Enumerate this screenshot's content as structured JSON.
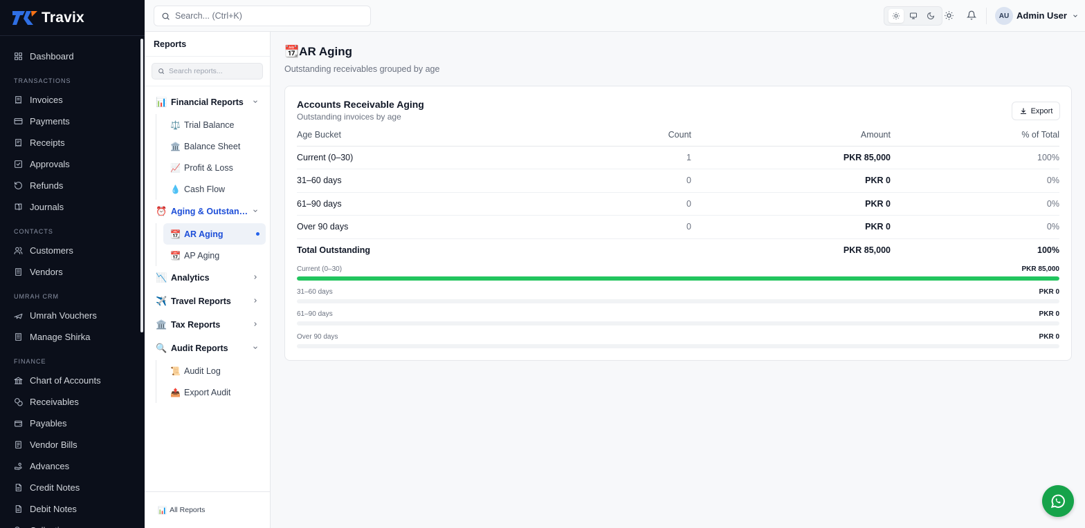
{
  "app": {
    "name": "Travix"
  },
  "sidebar": {
    "items": [
      {
        "label": "Dashboard",
        "icon": "dashboard-icon"
      },
      {
        "section": "TRANSACTIONS"
      },
      {
        "label": "Invoices",
        "icon": "invoice-icon"
      },
      {
        "label": "Payments",
        "icon": "card-icon"
      },
      {
        "label": "Receipts",
        "icon": "receipt-icon"
      },
      {
        "label": "Approvals",
        "icon": "check-square-icon"
      },
      {
        "label": "Refunds",
        "icon": "refund-icon"
      },
      {
        "label": "Journals",
        "icon": "book-icon"
      },
      {
        "section": "CONTACTS"
      },
      {
        "label": "Customers",
        "icon": "users-icon"
      },
      {
        "label": "Vendors",
        "icon": "building-icon"
      },
      {
        "section": "UMRAH CRM"
      },
      {
        "label": "Umrah Vouchers",
        "icon": "plane-icon"
      },
      {
        "label": "Manage Shirka",
        "icon": "building-icon"
      },
      {
        "section": "FINANCE"
      },
      {
        "label": "Chart of Accounts",
        "icon": "landmark-icon"
      },
      {
        "label": "Receivables",
        "icon": "coins-icon"
      },
      {
        "label": "Payables",
        "icon": "wallet-icon"
      },
      {
        "label": "Vendor Bills",
        "icon": "bill-icon"
      },
      {
        "label": "Advances",
        "icon": "hand-coins-icon"
      },
      {
        "label": "Credit Notes",
        "icon": "file-icon"
      },
      {
        "label": "Debit Notes",
        "icon": "file-icon"
      },
      {
        "label": "Collections",
        "icon": "coins-icon"
      }
    ]
  },
  "topbar": {
    "search_placeholder": "Search... (Ctrl+K)",
    "user": {
      "initials": "AU",
      "name": "Admin User"
    }
  },
  "reports_panel": {
    "title": "Reports",
    "search_placeholder": "Search reports...",
    "groups": [
      {
        "label": "Financial Reports",
        "icon": "📊",
        "expanded": true,
        "items": [
          {
            "label": "Trial Balance",
            "icon": "⚖️"
          },
          {
            "label": "Balance Sheet",
            "icon": "🏛️"
          },
          {
            "label": "Profit & Loss",
            "icon": "📈"
          },
          {
            "label": "Cash Flow",
            "icon": "💧"
          }
        ]
      },
      {
        "label": "Aging & Outstanding",
        "icon": "⏰",
        "expanded": true,
        "active": true,
        "items": [
          {
            "label": "AR Aging",
            "icon": "📆",
            "selected": true
          },
          {
            "label": "AP Aging",
            "icon": "📆"
          }
        ]
      },
      {
        "label": "Analytics",
        "icon": "📉",
        "expanded": false,
        "items": []
      },
      {
        "label": "Travel Reports",
        "icon": "✈️",
        "expanded": false,
        "items": []
      },
      {
        "label": "Tax Reports",
        "icon": "🏛️",
        "expanded": false,
        "items": []
      },
      {
        "label": "Audit Reports",
        "icon": "🔍",
        "expanded": true,
        "items": [
          {
            "label": "Audit Log",
            "icon": "📜"
          },
          {
            "label": "Export Audit",
            "icon": "📤"
          }
        ]
      }
    ],
    "footer_label": "All Reports",
    "footer_icon": "📊"
  },
  "page": {
    "title_icon": "📆",
    "title": "AR Aging",
    "subtitle": "Outstanding receivables grouped by age"
  },
  "card": {
    "title": "Accounts Receivable Aging",
    "subtitle": "Outstanding invoices by age",
    "export_label": "Export",
    "columns": [
      "Age Bucket",
      "Count",
      "Amount",
      "% of Total"
    ],
    "rows": [
      {
        "bucket": "Current (0–30)",
        "count": "1",
        "amount": "PKR 85,000",
        "pct": "100%",
        "share": 1.0
      },
      {
        "bucket": "31–60 days",
        "count": "0",
        "amount": "PKR 0",
        "pct": "0%",
        "share": 0
      },
      {
        "bucket": "61–90 days",
        "count": "0",
        "amount": "PKR 0",
        "pct": "0%",
        "share": 0
      },
      {
        "bucket": "Over 90 days",
        "count": "0",
        "amount": "PKR 0",
        "pct": "0%",
        "share": 0
      }
    ],
    "total": {
      "label": "Total Outstanding",
      "amount": "PKR 85,000",
      "pct": "100%"
    },
    "bar_color": "#22c55e"
  }
}
